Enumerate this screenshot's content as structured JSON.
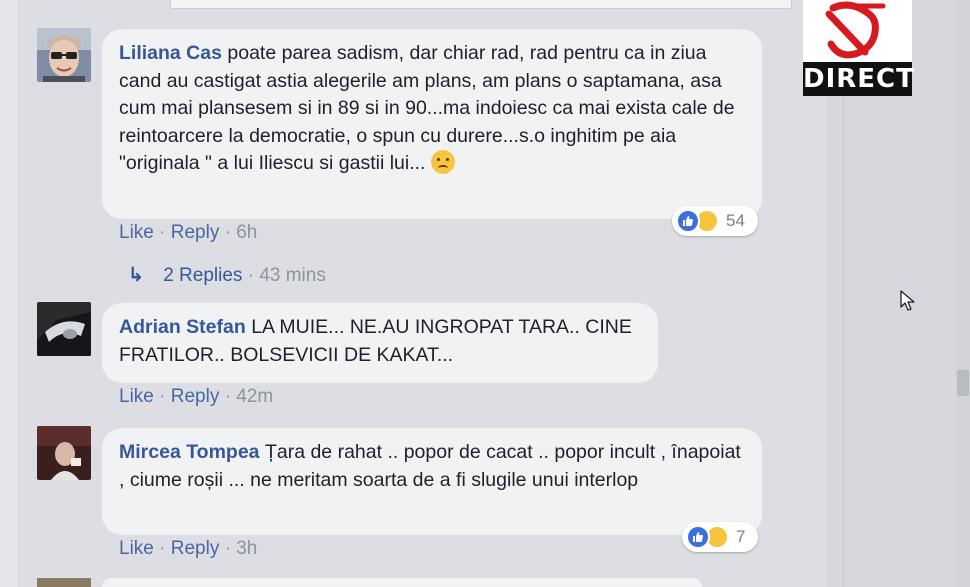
{
  "comments": [
    {
      "author": "Liliana Cas",
      "text": "poate parea sadism, dar chiar rad, rad pentru ca in ziua cand au castigat astia alegerile am plans, am plans o saptamana, asa cum mai plansesem si in 89 si in 90...ma indoiesc ca mai exista cale de reintoarcere la democratie, o spun cu durere...s.o inghitim pe aia \"originala \" a lui Iliescu si gastii lui...",
      "like_label": "Like",
      "reply_label": "Reply",
      "time": "6h",
      "reaction_count": "54",
      "replies_label": "2 Replies",
      "replies_time": "43 mins"
    },
    {
      "author": "Adrian Stefan",
      "text": "LA MUIE... NE.AU INGROPAT TARA.. CINE FRATILOR.. BOLSEVICII DE KAKAT...",
      "like_label": "Like",
      "reply_label": "Reply",
      "time": "42m"
    },
    {
      "author": "Mircea Tompea",
      "text": "Țara de rahat .. popor de cacat .. popor incult , înapoiat , ciume roșii ... ne meritam soarta de a fi slugile unui interlop",
      "like_label": "Like",
      "reply_label": "Reply",
      "time": "3h",
      "reaction_count": "7"
    }
  ],
  "overlay": {
    "label": "DIRECT"
  },
  "icons": {
    "replies_arrow": "reply-arrow-icon",
    "like_reaction": "like-reaction-icon",
    "sad_reaction": "sad-reaction-icon",
    "crying_emoji": "crying-emoji-icon",
    "cursor": "mouse-cursor-icon",
    "logo": "channel-logo-icon"
  },
  "colors": {
    "author_link": "#365899",
    "like_blue": "#3b6fe0",
    "sad_yellow": "#f6c53f",
    "logo_red": "#d71920"
  }
}
